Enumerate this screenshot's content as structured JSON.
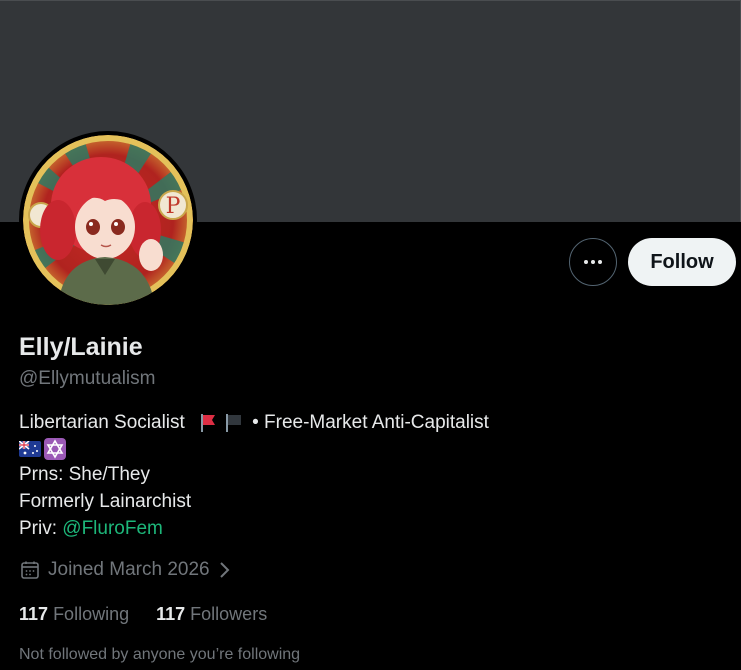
{
  "profile": {
    "display_name": "Elly/Lainie",
    "handle": "@Ellymutualism",
    "avatar_alt": "profile-avatar"
  },
  "actions": {
    "more_icon": "more-horizontal-icon",
    "follow_label": "Follow"
  },
  "bio": {
    "line1_text": "Libertarian Socialist",
    "line1_emojis": [
      "red-flag",
      "black-flag"
    ],
    "line1_suffix": " • Free-Market Anti-Capitalist",
    "line2_emojis": [
      "australia-flag",
      "star-of-david"
    ],
    "line3": "Prns: She/They",
    "line4": "Formerly Lainarchist",
    "line5_prefix": "Priv: ",
    "line5_link": "@FluroFem"
  },
  "joined": {
    "icon": "calendar-icon",
    "text": "Joined March 2026",
    "chevron_icon": "chevron-right-icon"
  },
  "stats": {
    "following_count": "117",
    "following_label": "Following",
    "followers_count": "117",
    "followers_label": "Followers"
  },
  "social_context": "Not followed by anyone you’re following",
  "colors": {
    "background": "#000000",
    "banner": "#333639",
    "text_primary": "#e7e9ea",
    "text_secondary": "#71767b",
    "link": "#1db77a",
    "follow_button_bg": "#eff3f4"
  }
}
